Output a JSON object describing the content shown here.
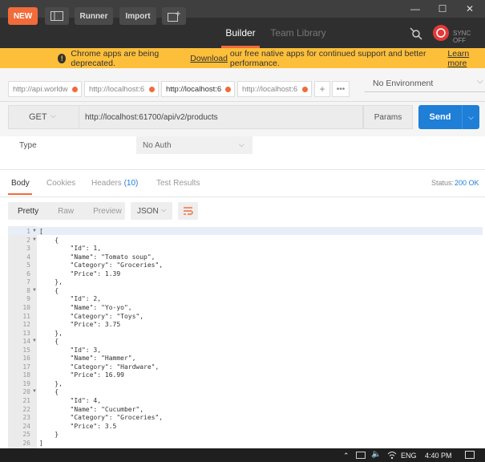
{
  "window": {
    "minimize": "—",
    "maximize": "☐",
    "close": "✕"
  },
  "header": {
    "new_label": "NEW",
    "runner_label": "Runner",
    "import_label": "Import",
    "tab_builder": "Builder",
    "tab_team_library": "Team Library",
    "sync_label": "SYNC OFF"
  },
  "banner": {
    "prefix": "Chrome apps are being deprecated.",
    "link_download": "Download",
    "middle": "our free native apps for continued support and better performance.",
    "link_learn_more": "Learn more"
  },
  "request_tabs": [
    {
      "label": "http://api.worldw"
    },
    {
      "label": "http://localhost:6"
    },
    {
      "label": "http://localhost:6"
    },
    {
      "label": "http://localhost:6"
    }
  ],
  "tab_controls": {
    "add": "+",
    "more": "•••"
  },
  "environment": {
    "selected": "No Environment"
  },
  "request": {
    "method": "GET",
    "url": "http://localhost:61700/api/v2/products",
    "params_label": "Params",
    "send_label": "Send"
  },
  "auth": {
    "type_label": "Type",
    "selected": "No Auth"
  },
  "response_tabs": {
    "body": "Body",
    "cookies": "Cookies",
    "headers": "Headers",
    "headers_count": "(10)",
    "test_results": "Test Results"
  },
  "status": {
    "label": "Status:",
    "value": "200 OK"
  },
  "format_bar": {
    "pretty": "Pretty",
    "raw": "Raw",
    "preview": "Preview",
    "json": "JSON"
  },
  "code_lines": [
    "[",
    "    {",
    "        \"Id\": 1,",
    "        \"Name\": \"Tomato soup\",",
    "        \"Category\": \"Groceries\",",
    "        \"Price\": 1.39",
    "    },",
    "    {",
    "        \"Id\": 2,",
    "        \"Name\": \"Yo-yo\",",
    "        \"Category\": \"Toys\",",
    "        \"Price\": 3.75",
    "    },",
    "    {",
    "        \"Id\": 3,",
    "        \"Name\": \"Hammer\",",
    "        \"Category\": \"Hardware\",",
    "        \"Price\": 16.99",
    "    },",
    "    {",
    "        \"Id\": 4,",
    "        \"Name\": \"Cucumber\",",
    "        \"Category\": \"Groceries\",",
    "        \"Price\": 3.5",
    "    }",
    "]"
  ],
  "fold_lines": [
    1,
    2,
    8,
    14,
    20
  ],
  "taskbar": {
    "lang": "ENG",
    "time": "4:40 PM"
  }
}
